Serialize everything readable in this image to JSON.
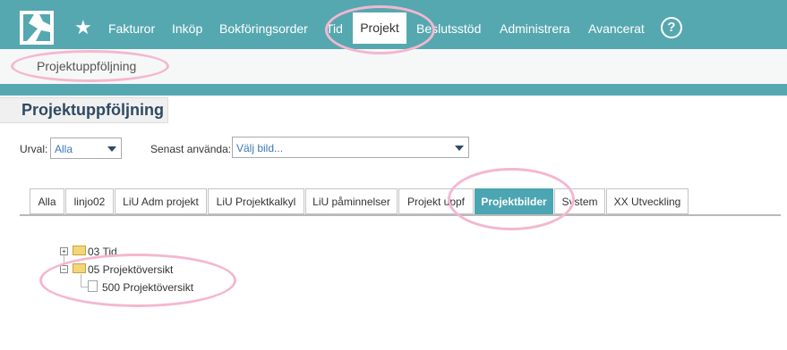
{
  "nav": {
    "items": [
      "Fakturor",
      "Inköp",
      "Bokföringsorder",
      "Tid",
      "Projekt",
      "Beslutsstöd",
      "Administrera",
      "Avancerat"
    ],
    "active": "Projekt",
    "help_glyph": "?"
  },
  "subnav": {
    "label": "Projektuppföljning"
  },
  "page": {
    "title": "Projektuppföljning"
  },
  "filters": {
    "urval_label": "Urval:",
    "urval_value": "Alla",
    "senast_label": "Senast använda:",
    "senast_value": "Välj bild..."
  },
  "tabs": [
    "Alla",
    "linjo02",
    "LiU Adm projekt",
    "LiU Projektkalkyl",
    "LiU påminnelser",
    "Projekt uppf",
    "Projektbilder",
    "System",
    "XX Utveckling"
  ],
  "active_tab": "Projektbilder",
  "tree": {
    "node1": {
      "label": "03 Tid",
      "expander": "+"
    },
    "node2": {
      "label": "05 Projektöversikt",
      "expander": "−"
    },
    "leaf": {
      "label": "500 Projektöversikt"
    }
  },
  "colors": {
    "header": "#56a8b0",
    "active_tab": "#4ca5b2",
    "highlight_ring": "#f4b7d0",
    "title": "#2f4a63"
  },
  "icons": [
    "app-logo-icon",
    "star-icon",
    "help-icon",
    "dropdown-caret-icon",
    "folder-icon",
    "document-icon"
  ]
}
